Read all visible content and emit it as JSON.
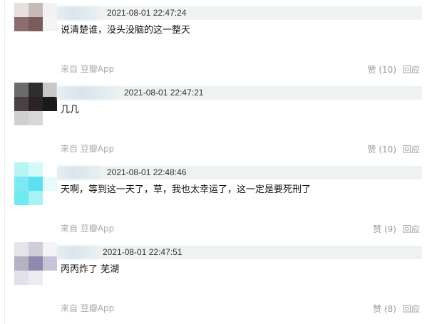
{
  "comments": [
    {
      "time": "2021-08-01 22:47:24",
      "content": "说清楚谁，没头没脑的这一整天",
      "source": "来自 豆瓣App",
      "like": "赞 (10)",
      "reply": "回应",
      "avatar_colors": [
        "#e8e0e0",
        "#c8b8b8",
        "#f2f2f2",
        "#8a6e6e",
        "#7a5c5c",
        "#f4f4f4",
        "#ffffff",
        "#ffffff",
        "#ffffff"
      ]
    },
    {
      "time": "2021-08-01 22:47:21",
      "content": "几几",
      "source": "来自 豆瓣App",
      "like": "赞 (10)",
      "reply": "回应",
      "avatar_colors": [
        "#6b6b6b",
        "#2e2e2e",
        "#c8c8c8",
        "#4a4242",
        "#2a2424",
        "#1a1a1a",
        "#cfcfcf",
        "#d8d8d8",
        "#ffffff"
      ]
    },
    {
      "time": "2021-08-01 22:48:46",
      "content": "天啊，等到这一天了，草，我也太幸运了，这一定是要死刑了",
      "source": "来自 豆瓣App",
      "like": "赞 (9)",
      "reply": "回应",
      "avatar_colors": [
        "#b8f4f4",
        "#d2fafa",
        "#ffffff",
        "#7de9f2",
        "#5ae0ee",
        "#e6fbfb",
        "#6feaf0",
        "#a6f2f4",
        "#ffffff"
      ]
    },
    {
      "time": "2021-08-01 22:47:51",
      "content": "丙丙炸了 芜湖",
      "source": "来自 豆瓣App",
      "like": "赞 (8)",
      "reply": "回应",
      "avatar_colors": [
        "#e6e4ea",
        "#d0ccdc",
        "#f4f4f6",
        "#b4b2c4",
        "#8e8ab0",
        "#c8c4d8",
        "#e2e0e8",
        "#ececf0",
        "#ffffff"
      ]
    }
  ]
}
